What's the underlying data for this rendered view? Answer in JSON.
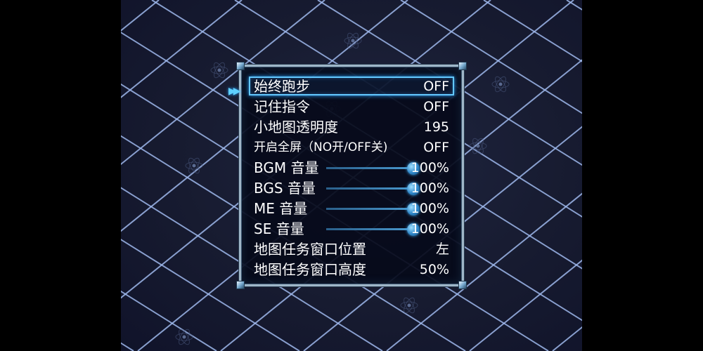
{
  "options": [
    {
      "label": "始终跑步",
      "value": "OFF",
      "type": "toggle",
      "selected": true
    },
    {
      "label": "记住指令",
      "value": "OFF",
      "type": "toggle"
    },
    {
      "label": "小地图透明度",
      "value": "195",
      "type": "number"
    },
    {
      "label": "开启全屏（NO开/OFF关)",
      "value": "OFF",
      "type": "toggle"
    },
    {
      "label": "BGM 音量",
      "value": "100%",
      "type": "slider",
      "level": 1.0
    },
    {
      "label": "BGS 音量",
      "value": "100%",
      "type": "slider",
      "level": 1.0
    },
    {
      "label": "ME 音量",
      "value": "100%",
      "type": "slider",
      "level": 1.0
    },
    {
      "label": "SE 音量",
      "value": "100%",
      "type": "slider",
      "level": 1.0
    },
    {
      "label": "地图任务窗口位置",
      "value": "左",
      "type": "choice"
    },
    {
      "label": "地图任务窗口高度",
      "value": "50%",
      "type": "choice"
    }
  ],
  "colors": {
    "background": "#171b30",
    "grid_line": "#9fb9ec",
    "window_border": "#9fb6c8",
    "highlight": "#63c8ff",
    "slider_knob": "#2f86c8"
  },
  "icons": {
    "cursor": "double-triangle-right-icon",
    "background_decoration": "atom-icon"
  }
}
